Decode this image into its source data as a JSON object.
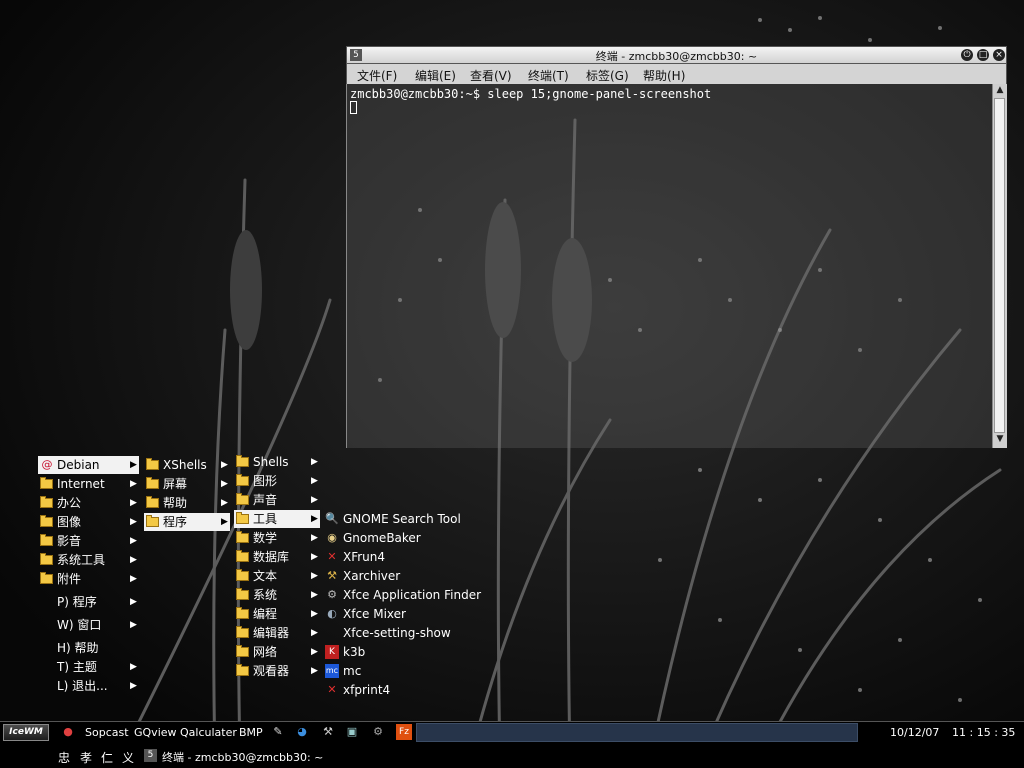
{
  "terminal": {
    "title": "终端 - zmcbb30@zmcbb30: ~",
    "menus": [
      "文件(F)",
      "编辑(E)",
      "查看(V)",
      "终端(T)",
      "标签(G)",
      "帮助(H)"
    ],
    "command_line": "zmcbb30@zmcbb30:~$ sleep 15;gnome-panel-screenshot",
    "window_icon": "terminal-icon"
  },
  "start_menu": {
    "main": [
      {
        "label": "Debian",
        "icon": "debian-swirl-icon",
        "submenu": true,
        "selected": true
      },
      {
        "label": "Internet",
        "icon": "folder-icon",
        "submenu": true
      },
      {
        "label": "办公",
        "icon": "folder-icon",
        "submenu": true
      },
      {
        "label": "图像",
        "icon": "folder-icon",
        "submenu": true
      },
      {
        "label": "影音",
        "icon": "folder-icon",
        "submenu": true
      },
      {
        "label": "系统工具",
        "icon": "folder-icon",
        "submenu": true
      },
      {
        "label": "附件",
        "icon": "folder-icon",
        "submenu": true
      },
      {
        "label": "P) 程序",
        "submenu": true
      },
      {
        "label": "W) 窗口",
        "submenu": true
      },
      {
        "label": "H) 帮助",
        "submenu": false
      },
      {
        "label": "T) 主题",
        "submenu": true
      },
      {
        "label": "L) 退出...",
        "submenu": true
      }
    ],
    "debian": [
      {
        "label": "XShells",
        "submenu": true
      },
      {
        "label": "屏幕",
        "submenu": true
      },
      {
        "label": "帮助",
        "submenu": true
      },
      {
        "label": "程序",
        "submenu": true,
        "selected": true
      }
    ],
    "programs": [
      {
        "label": "Shells",
        "submenu": true
      },
      {
        "label": "图形",
        "submenu": true
      },
      {
        "label": "声音",
        "submenu": true
      },
      {
        "label": "工具",
        "submenu": true,
        "selected": true
      },
      {
        "label": "数学",
        "submenu": true
      },
      {
        "label": "数据库",
        "submenu": true
      },
      {
        "label": "文本",
        "submenu": true
      },
      {
        "label": "系统",
        "submenu": true
      },
      {
        "label": "编程",
        "submenu": true
      },
      {
        "label": "编辑器",
        "submenu": true
      },
      {
        "label": "网络",
        "submenu": true
      },
      {
        "label": "观看器",
        "submenu": true
      }
    ],
    "tools": [
      {
        "label": "GNOME Search Tool",
        "icon": "magnifier-icon"
      },
      {
        "label": "GnomeBaker",
        "icon": "cd-icon"
      },
      {
        "label": "XFrun4",
        "icon": "x-icon"
      },
      {
        "label": "Xarchiver",
        "icon": "archiver-icon"
      },
      {
        "label": "Xfce Application Finder",
        "icon": "app-finder-icon"
      },
      {
        "label": "Xfce Mixer",
        "icon": "speaker-icon"
      },
      {
        "label": "Xfce-setting-show",
        "icon": "blank-icon"
      },
      {
        "label": "k3b",
        "icon": "k3b-icon"
      },
      {
        "label": "mc",
        "icon": "mc-icon"
      },
      {
        "label": "xfprint4",
        "icon": "x-icon"
      }
    ]
  },
  "taskbar": {
    "start_label": "IceWM",
    "launchers": [
      "Sopcast",
      "GQview",
      "Qalculater",
      "BMP"
    ],
    "clock_date": "10/12/07",
    "clock_time": "11 : 15 : 35",
    "workspaces": [
      "忠",
      "孝",
      "仁",
      "义"
    ],
    "task_label": "终端 - zmcbb30@zmcbb30: ~"
  },
  "colors": {
    "menu_highlight": "#f2f2f2",
    "tasks_area": "#26344a",
    "folder": "#f3c844"
  }
}
